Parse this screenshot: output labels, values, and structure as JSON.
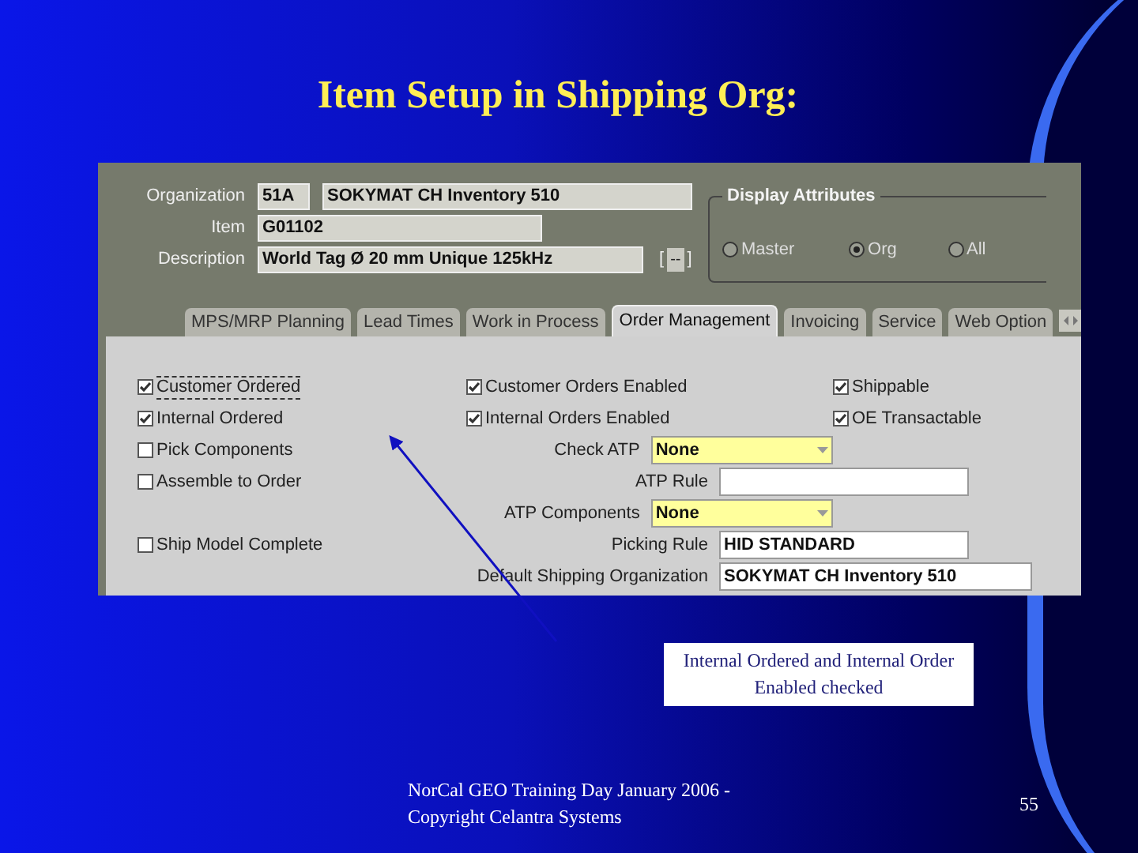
{
  "slide": {
    "title": "Item Setup in Shipping Org:",
    "callout": "Internal Ordered and Internal Order Enabled checked",
    "footer": "NorCal GEO Training Day January 2006 -  Copyright Celantra Systems",
    "page_number": "55"
  },
  "header": {
    "organization": {
      "label": "Organization",
      "code": "51A",
      "name": "SOKYMAT CH Inventory 510"
    },
    "item": {
      "label": "Item",
      "value": "G01102"
    },
    "description": {
      "label": "Description",
      "value": "World Tag Ø 20 mm Unique 125kHz"
    },
    "flex_field": {
      "open": "[",
      "button": "--",
      "close": "]"
    },
    "display_attributes": {
      "title": "Display Attributes",
      "options": [
        {
          "label": "Master",
          "selected": false
        },
        {
          "label": "Org",
          "selected": true
        },
        {
          "label": "All",
          "selected": false
        }
      ]
    }
  },
  "tabs": [
    {
      "label": "MPS/MRP Planning",
      "selected": false
    },
    {
      "label": "Lead Times",
      "selected": false
    },
    {
      "label": "Work in Process",
      "selected": false
    },
    {
      "label": "Order Management",
      "selected": true
    },
    {
      "label": "Invoicing",
      "selected": false
    },
    {
      "label": "Service",
      "selected": false
    },
    {
      "label": "Web Option",
      "selected": false
    }
  ],
  "rows": [
    {
      "left": {
        "label": "Customer Ordered",
        "checked": true,
        "focused": true
      },
      "middle": {
        "kind": "checkbox",
        "label": "Customer Orders Enabled",
        "checked": true
      },
      "right": {
        "label": "Shippable",
        "checked": true
      }
    },
    {
      "left": {
        "label": "Internal Ordered",
        "checked": true,
        "focused": false
      },
      "middle": {
        "kind": "checkbox",
        "label": "Internal Orders Enabled",
        "checked": true
      },
      "right": {
        "label": "OE Transactable",
        "checked": true
      }
    },
    {
      "left": {
        "label": "Pick Components",
        "checked": false,
        "focused": false
      },
      "middle": {
        "kind": "dropdown",
        "label": "Check ATP",
        "value": "None"
      }
    },
    {
      "left": {
        "label": "Assemble to Order",
        "checked": false,
        "focused": false
      },
      "middle": {
        "kind": "text",
        "label": "ATP Rule"
      }
    },
    {
      "middle": {
        "kind": "dropdown",
        "label": "ATP Components",
        "value": "None"
      }
    },
    {
      "left": {
        "label": "Ship Model Complete",
        "checked": false,
        "focused": false
      },
      "middle": {
        "kind": "text",
        "label": "Picking Rule",
        "value": "HID STANDARD"
      }
    },
    {
      "middle": {
        "kind": "wide",
        "label": "Default Shipping Organization",
        "value": "SOKYMAT CH Inventory 510"
      }
    }
  ]
}
